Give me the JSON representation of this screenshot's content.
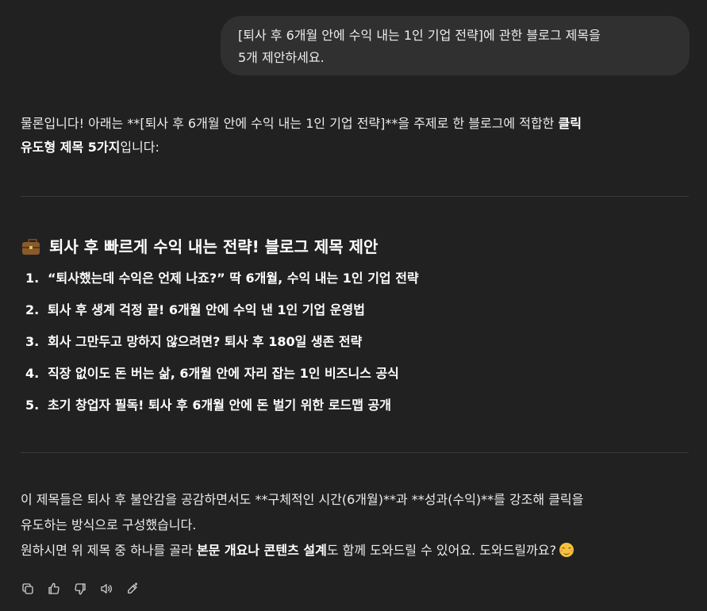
{
  "user_message": {
    "line1": "[퇴사 후 6개월 안에 수익 내는 1인 기업 전략]에 관한 블로그 제목을",
    "line2": "5개 제안하세요."
  },
  "assistant": {
    "intro": {
      "part1": "물론입니다! 아래는 **[퇴사 후 6개월 안에 수익 내는 1인 기업 전략]**을 주제로 한 블로그에 적합한 ",
      "bold1": "클릭",
      "bold2": "유도형 제목 5가지",
      "part2": "입니다:"
    },
    "heading": {
      "icon": "briefcase-icon",
      "text": "퇴사 후 빠르게 수익 내는 전략! 블로그 제목 제안"
    },
    "titles": [
      {
        "num": "1.",
        "text": "“퇴사했는데 수익은 언제 나죠?” 딱 6개월, 수익 내는 1인 기업 전략"
      },
      {
        "num": "2.",
        "text": "퇴사 후 생계 걱정 끝! 6개월 안에 수익 낸 1인 기업 운영법"
      },
      {
        "num": "3.",
        "text": "회사 그만두고 망하지 않으려면? 퇴사 후 180일 생존 전략"
      },
      {
        "num": "4.",
        "text": "직장 없이도 돈 버는 삶, 6개월 안에 자리 잡는 1인 비즈니스 공식"
      },
      {
        "num": "5.",
        "text": "초기 창업자 필독! 퇴사 후 6개월 안에 돈 벌기 위한 로드맵 공개"
      }
    ],
    "outro": {
      "p1_line1": "이 제목들은 퇴사 후 불안감을 공감하면서도 **구체적인 시간(6개월)**과 **성과(수익)**를 강조해 클릭을",
      "p1_line2": "유도하는 방식으로 구성했습니다.",
      "p2_part1": "원하시면 위 제목 중 하나를 골라 ",
      "p2_bold": "본문 개요나 콘텐츠 설계",
      "p2_part2": "도 함께 도와드릴 수 있어요. 도와드릴까요?",
      "emoji": "smiling-face-emoji"
    },
    "actions": [
      {
        "name": "copy-icon"
      },
      {
        "name": "thumbs-up-icon"
      },
      {
        "name": "thumbs-down-icon"
      },
      {
        "name": "read-aloud-icon"
      },
      {
        "name": "edit-icon"
      }
    ]
  }
}
